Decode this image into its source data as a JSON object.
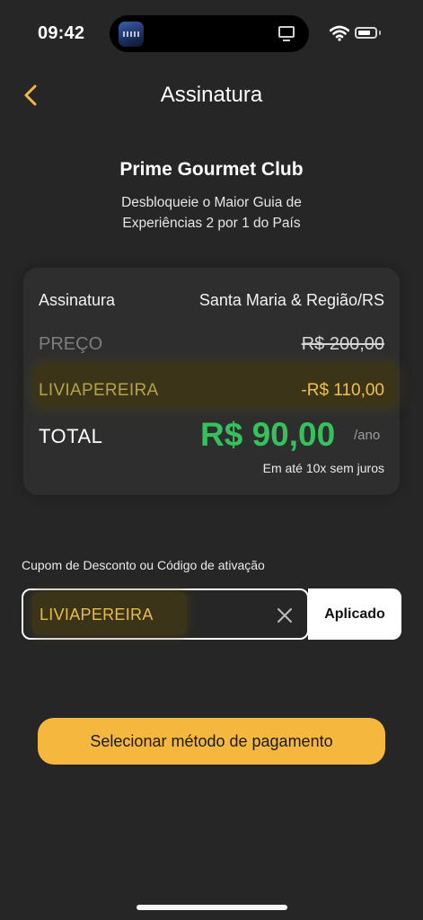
{
  "status_bar": {
    "time": "09:42",
    "island_app_icon": "app-thumbnail-icon",
    "island_activity_icon": "tv-icon",
    "wifi_icon": "wifi-icon",
    "battery_icon": "battery-icon"
  },
  "nav": {
    "back_icon": "chevron-left-icon",
    "title": "Assinatura"
  },
  "header": {
    "title": "Prime Gourmet Club",
    "subtitle": "Desbloqueie o Maior Guia de Experiências 2 por 1 do País"
  },
  "summary": {
    "subscription_label": "Assinatura",
    "subscription_value": "Santa Maria & Região/RS",
    "price_label": "PREÇO",
    "price_value": "R$ 200,00",
    "discount_label": "LIVIAPEREIRA",
    "discount_value": "-R$ 110,00",
    "total_label": "TOTAL",
    "total_value": "R$ 90,00",
    "total_period": "/ano",
    "installments": "Em até 10x sem juros"
  },
  "coupon": {
    "label": "Cupom de Desconto ou Código de ativação",
    "value": "LIVIAPEREIRA",
    "clear_icon": "close-icon",
    "status_button": "Aplicado"
  },
  "actions": {
    "pay_button": "Selecionar método de pagamento"
  },
  "colors": {
    "background": "#262626",
    "accent": "#f6b73e",
    "total_green": "#37c15e",
    "highlight": "#3b3418"
  }
}
